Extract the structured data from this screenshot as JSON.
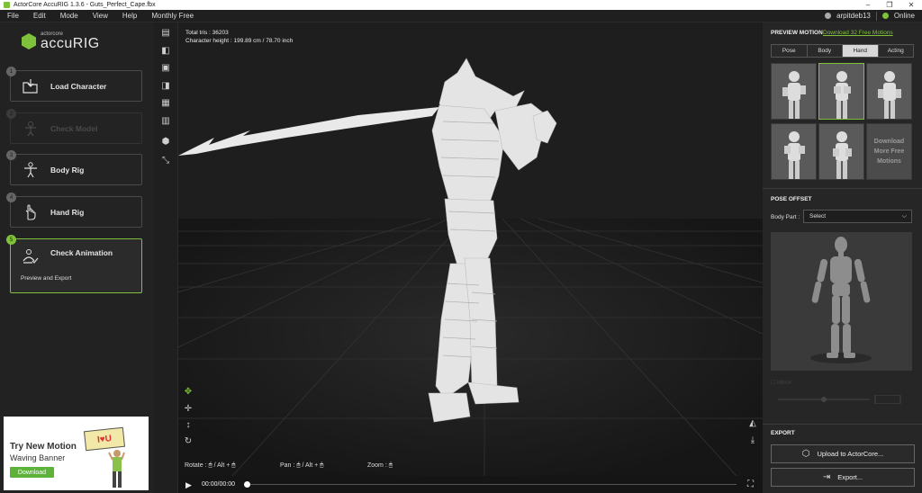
{
  "window": {
    "title": "ActorCore AccuRIG 1.3.6 - Guts_Perfect_Cape.fbx",
    "controls": [
      "–",
      "❐",
      "✕"
    ]
  },
  "menu": {
    "items": [
      "File",
      "Edit",
      "Mode",
      "View",
      "Help",
      "Monthly Free"
    ],
    "username": "arpitdeb13",
    "status": "Online"
  },
  "brand": {
    "small": "actorcore",
    "big": "accuRIG"
  },
  "steps": [
    {
      "num": "1",
      "label": "Load Character",
      "icon": "folder-import-icon",
      "state": "normal"
    },
    {
      "num": "2",
      "label": "Check Model",
      "icon": "model-check-icon",
      "state": "disabled"
    },
    {
      "num": "3",
      "label": "Body Rig",
      "icon": "body-rig-icon",
      "state": "normal"
    },
    {
      "num": "4",
      "label": "Hand Rig",
      "icon": "hand-rig-icon",
      "state": "normal"
    },
    {
      "num": "5",
      "label": "Check Animation",
      "sub": "Preview and Export",
      "icon": "animation-check-icon",
      "state": "active"
    }
  ],
  "banner": {
    "title": "Try New Motion",
    "subtitle": "Waving Banner",
    "button": "Download",
    "sign": "I♥U"
  },
  "viewport": {
    "total_tris": "Total tris : 36203",
    "char_height": "Character height : 199.89 cm / 78.70 inch",
    "hint_rotate": "Rotate :",
    "hint_rotate_alt": "/ Alt +",
    "hint_pan": "Pan :",
    "hint_pan_alt": "/ Alt +",
    "hint_zoom": "Zoom :"
  },
  "playback": {
    "time": "00:00/00:00"
  },
  "right": {
    "preview_motion": "PREVIEW MOTION",
    "download_link": "Download 32 Free Motions",
    "tabs": [
      "Pose",
      "Body",
      "Hand",
      "Acting"
    ],
    "selected_tab": "Hand",
    "more_motions": "Download More Free Motions",
    "pose_offset": "POSE OFFSET",
    "body_part_label": "Body Part :",
    "body_part_value": "Select",
    "mirror_label": "Mirror",
    "export_heading": "EXPORT",
    "upload_button": "Upload to ActorCore...",
    "export_button": "Export..."
  },
  "colors": {
    "accent": "#7fc13a",
    "panel": "#222222",
    "viewport": "#1e1e1e"
  }
}
